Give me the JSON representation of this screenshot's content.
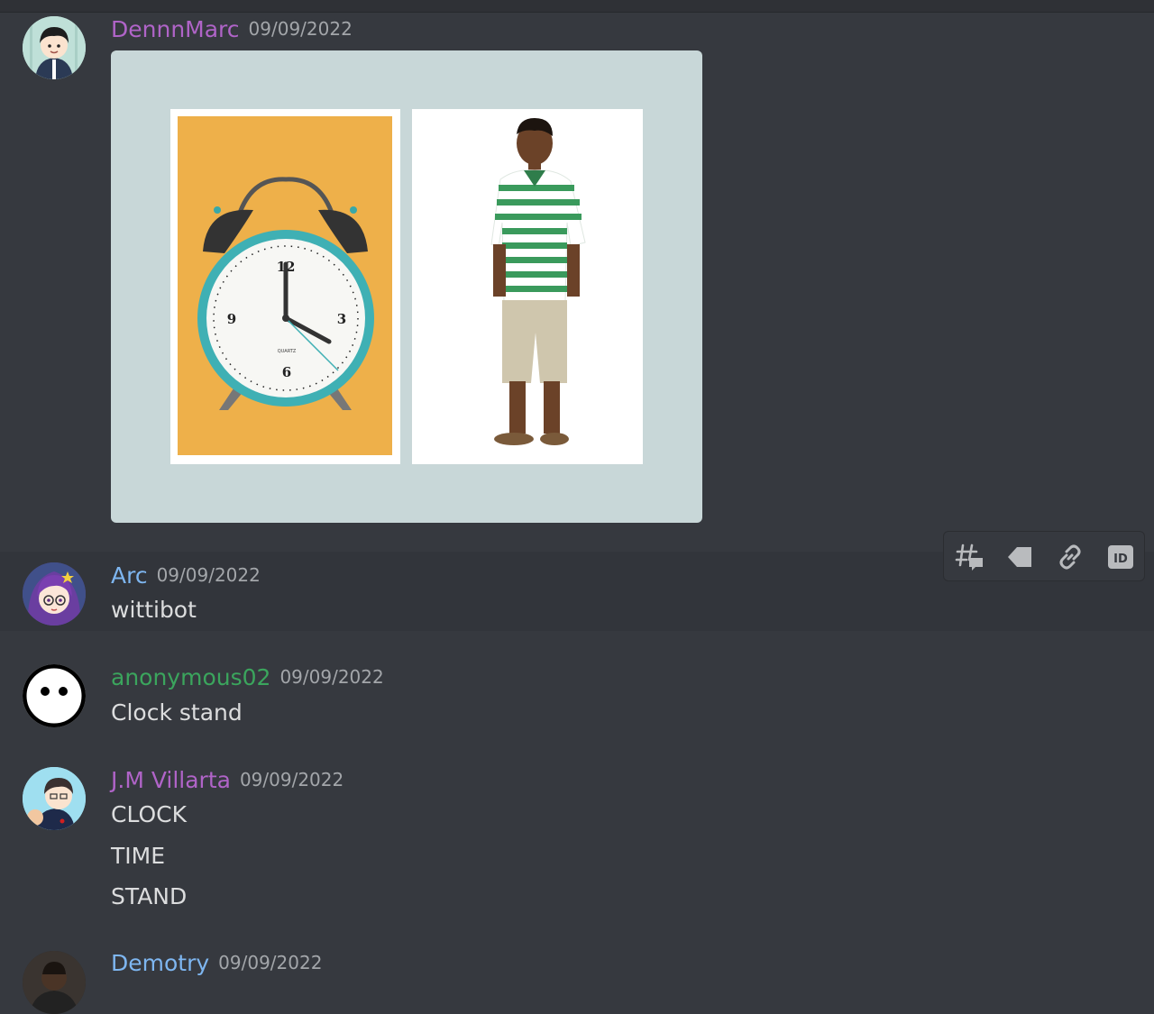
{
  "messages": [
    {
      "username": "DennnMarc",
      "username_color": "#b064c8",
      "timestamp": "09/09/2022",
      "attachment": {
        "images": [
          "alarm-clock-image",
          "boy-standing-image"
        ]
      }
    },
    {
      "username": "Arc",
      "username_color": "#7eb6f0",
      "timestamp": "09/09/2022",
      "lines": [
        "wittibot"
      ]
    },
    {
      "username": "anonymous02",
      "username_color": "#3ba55d",
      "timestamp": "09/09/2022",
      "lines": [
        "Clock stand"
      ]
    },
    {
      "username": "J.M Villarta",
      "username_color": "#b064c8",
      "timestamp": "09/09/2022",
      "lines": [
        "CLOCK",
        "TIME",
        "STAND"
      ]
    },
    {
      "username": "Demotry",
      "username_color": "#7eb6f0",
      "timestamp": "09/09/2022"
    }
  ],
  "alarm_clock": {
    "face_numbers": [
      "12",
      "3",
      "6",
      "9"
    ],
    "brand": "QUARTZ"
  },
  "hover_toolbar": {
    "buttons": [
      "create-thread-icon",
      "tag-icon",
      "copy-link-icon",
      "copy-id-icon"
    ],
    "id_label": "ID"
  }
}
